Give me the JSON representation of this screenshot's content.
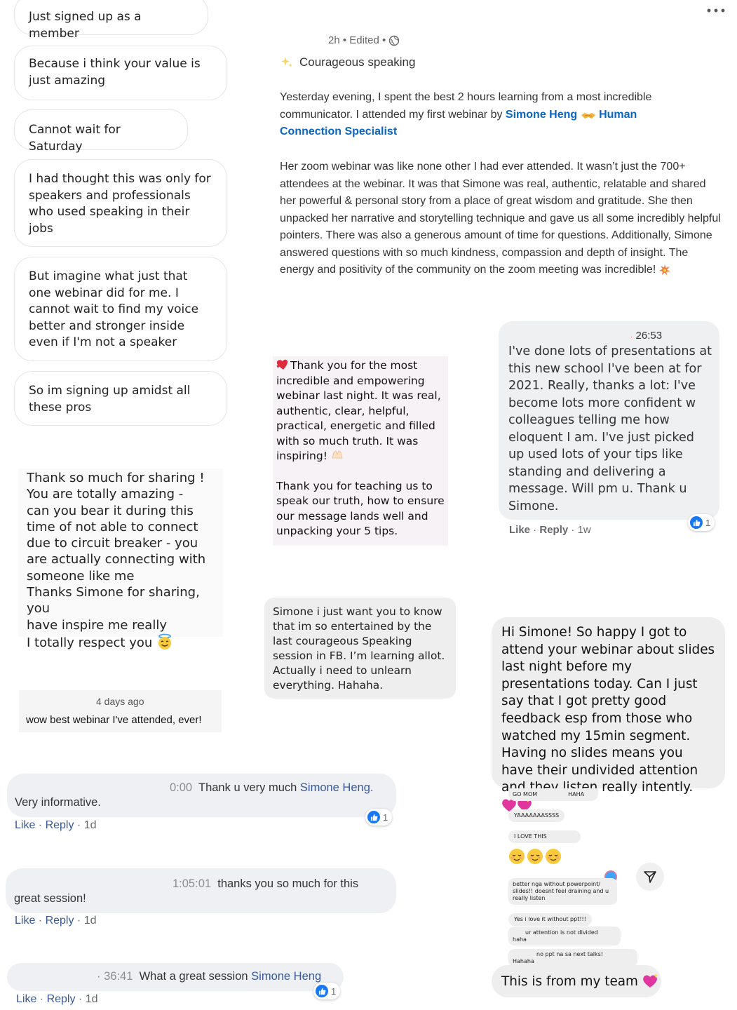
{
  "menu": {
    "icon": "more-horizontal-icon"
  },
  "left_chat": [
    "Just signed up as a member",
    "Because i think your value is just amazing",
    "Cannot wait for Saturday",
    "I had thought this was only for speakers and professionals who used speaking in their jobs",
    "But imagine what just that one webinar did for me. I cannot wait to find my voice better and stronger inside even if I'm not a speaker",
    "So im signing up amidst all these pros"
  ],
  "post": {
    "meta": "2h • Edited •",
    "globe_icon": "globe-icon",
    "sparkle_icon": "sparkles-icon",
    "title": "Courageous speaking",
    "p1_before": "Yesterday evening, I spent the best 2 hours learning from a most incredible communicator. I attended my first webinar by ",
    "link1": "Simone Heng",
    "handshake_icon": "handshake-icon",
    "link2": "Human Connection Specialist",
    "p2": "Her zoom webinar was like none other I had ever attended. It wasn’t just the 700+ attendees at the webinar. It was that Simone was real, authentic, relatable and shared her powerful & personal story from a place of great wisdom and gratitude. She then unpacked her narrative and storytelling technique and gave us all some incredibly helpful pointers. There was also a generous amount of time for questions. Additionally, Simone answered questions with so much kindness, compassion and depth of insight. The energy and positivity of the community on the zoom meeting was incredible!",
    "burst_icon": "collision-icon"
  },
  "thank_note": {
    "heart_icon": "heart-icon",
    "p1": "Thank you for the most incredible and empowering webinar last night. It was real, authentic, clear, helpful, practical, energetic and filled with so much truth. It was inspiring!",
    "hands_icon": "praise-hands-icon",
    "p2": "Thank you for teaching us to speak our truth, how to ensure our message lands well and unpacking your 5 tips."
  },
  "presentation_comment": {
    "timestamp": "26:53",
    "text": "I've done lots of presentations at this new school I've been at for 2021. Really, thanks a lot: I've become lots more confident w colleagues telling me how eloquent I am. I've just picked up used lots of your tips like standing and delivering a message. Will pm u. Thank u Simone.",
    "like_count": "1",
    "actions": {
      "like": "Like",
      "reply": "Reply",
      "time": "1w"
    }
  },
  "thanks_sharing": {
    "lines": [
      "Thank so much for sharing !",
      "You are totally amazing -",
      "can you bear it during this",
      "time of not able to connect",
      "due to circuit breaker - you",
      "are actually connecting with",
      "someone like me",
      "Thanks Simone for sharing, you",
      "have inspire  me really",
      "I totally respect you"
    ],
    "emoji_icon": "smiling-face-with-halo-icon"
  },
  "entertained": "Simone i just want you to know that im so entertained by the last courageous Speaking session in FB. I’m learning allot. Actually i need to unlearn everything. Hahaha.",
  "slides_message": {
    "text": "Hi Simone! So happy I got to attend your webinar about slides last night before my presentations today. Can I just say that I got pretty good feedback esp from those who watched my 15min segment. Having no slides means you have their undivided attention and they listen really intently.",
    "emoji_icon": "sparkling-hearts-icon"
  },
  "four_days": {
    "time": "4 days ago",
    "text": "wow best webinar I've attended, ever!"
  },
  "fb_comments": [
    {
      "time": "0:00",
      "text": "Thank u very much",
      "mention": "Simone Heng.",
      "second_line": "Very informative.",
      "like": "Like",
      "reply": "Reply",
      "ago": "1d",
      "reactions": "1"
    },
    {
      "time": "1:05:01",
      "text": "thanks you so much for this",
      "mention": "",
      "second_line": "great session!",
      "like": "Like",
      "reply": "Reply",
      "ago": "1d",
      "reactions": ""
    },
    {
      "time": "36:41",
      "text": "What a great session",
      "mention": "Simone Heng",
      "second_line": "",
      "like": "Like",
      "reply": "Reply",
      "ago": "1d",
      "reactions": "1"
    }
  ],
  "team_chat": {
    "msgs": [
      "GO MOM",
      "HAHA",
      "YAAAAAAASSSS",
      "I LOVE THIS"
    ],
    "smiles_icon": "relieved-face-icon",
    "long_msg": "better nga without powerpoint/ slides!! doesnt feel draining and u really listen",
    "msg5": "Yes i love it without ppt!!!",
    "msg6_a": "ur attention is not divided",
    "msg6_b": "haha",
    "msg7": "no ppt na sa next talks!",
    "msg7_b": "Hahaha",
    "send_icon": "send-icon",
    "caption": "This is from my team",
    "heart_icon": "sparkling-heart-icon"
  }
}
